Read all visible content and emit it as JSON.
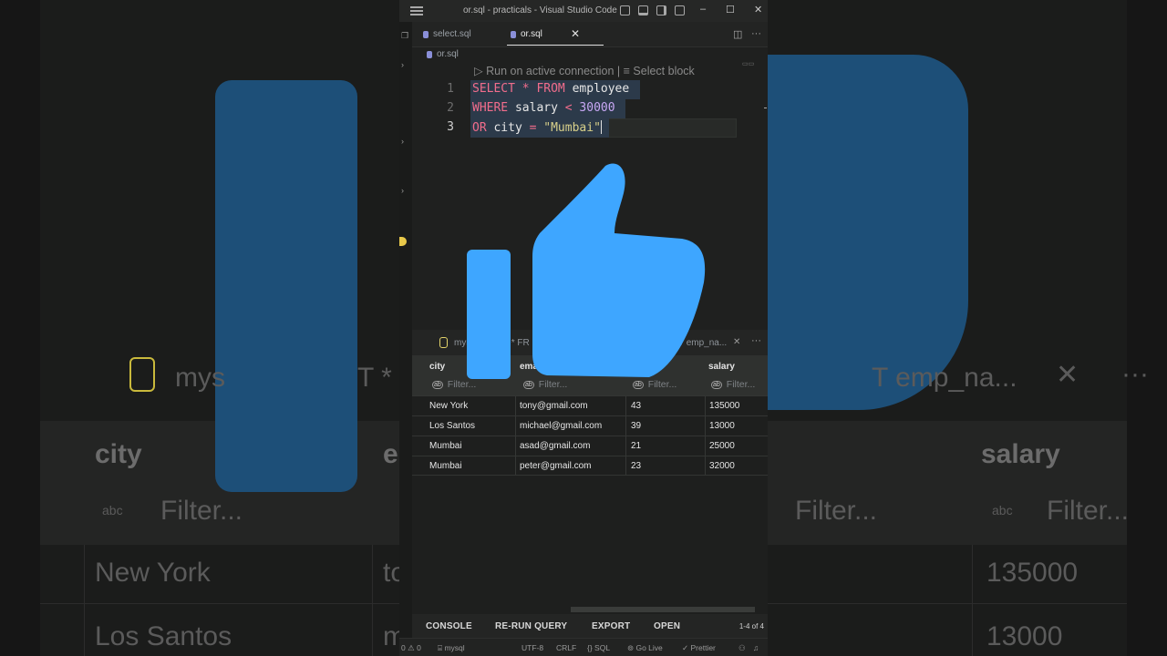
{
  "window": {
    "title": "or.sql - practicals - Visual Studio Code",
    "controls": {
      "minimize": "–",
      "maximize": "☐",
      "close": "✕"
    }
  },
  "tabs": [
    {
      "label": "select.sql",
      "active": false
    },
    {
      "label": "or.sql",
      "active": true
    }
  ],
  "breadcrumb": "or.sql",
  "codelens": "▷ Run on active connection | ≡ Select block",
  "code": {
    "line_numbers": [
      "1",
      "2",
      "3"
    ],
    "line1": {
      "kw1": "SELECT",
      "op": " * ",
      "kw2": "FROM",
      "rest": " employee"
    },
    "line2": {
      "kw": "WHERE",
      "mid": " salary ",
      "op": "<",
      "num": " 30000"
    },
    "line3": {
      "kw": "OR",
      "mid": " city ",
      "op": "=",
      "str": " \"Mumbai\""
    }
  },
  "results": {
    "tab_label_left": "mys",
    "tab_label_mid": "T * FR",
    "tab_label_right": "T emp_na...",
    "columns": [
      "city",
      "ema",
      "",
      "salary"
    ],
    "filter_placeholder": "Filter...",
    "rows": [
      {
        "city": "New York",
        "email": "tony@gmail.com",
        "age": "43",
        "salary": "135000"
      },
      {
        "city": "Los Santos",
        "email": "michael@gmail.com",
        "age": "39",
        "salary": "13000"
      },
      {
        "city": "Mumbai",
        "email": "asad@gmail.com",
        "age": "21",
        "salary": "25000"
      },
      {
        "city": "Mumbai",
        "email": "peter@gmail.com",
        "age": "23",
        "salary": "32000"
      }
    ],
    "footer": {
      "console": "CONSOLE",
      "rerun": "RE-RUN QUERY",
      "export": "EXPORT",
      "open": "OPEN",
      "count": "1-4 of 4"
    }
  },
  "statusbar": {
    "problems": "0 ⚠ 0",
    "connection": "mysql",
    "encoding": "UTF-8",
    "eol": "CRLF",
    "language": "SQL",
    "golive": "Go Live",
    "prettier": "Prettier"
  },
  "background": {
    "tab_text_left": "mys",
    "tab_text_mid": "T * F",
    "tab_text_right": "T emp_na...",
    "col_city": "city",
    "col_e": "e",
    "col_salary": "salary",
    "filter": "Filter...",
    "row1_city": "New York",
    "row1_e": "to",
    "row1_salary": "135000",
    "row2_city": "Los Santos",
    "row2_e": "m",
    "row2_salary": "13000"
  },
  "colors": {
    "keyword": "#f26d8c",
    "number": "#c8a8f5",
    "string": "#d8d08a",
    "thumb": "#3ea6ff"
  }
}
